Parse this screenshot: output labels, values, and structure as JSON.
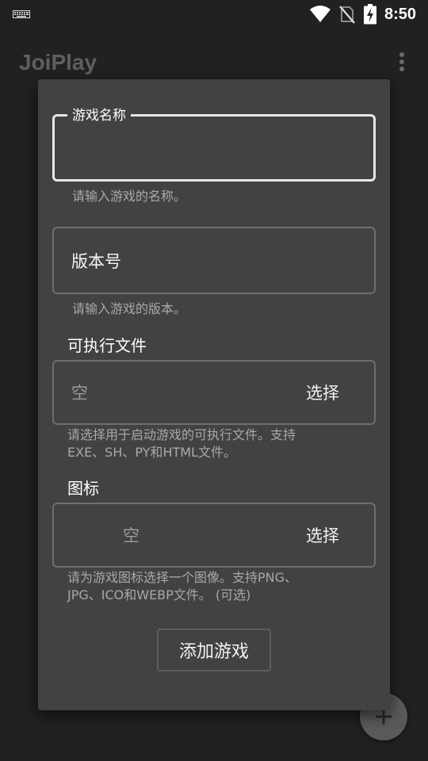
{
  "status_bar": {
    "time": "8:50",
    "icons": [
      "keyboard-icon",
      "wifi-icon",
      "no-sim-icon",
      "battery-charging-icon"
    ]
  },
  "app_bar": {
    "title": "JoiPlay",
    "menu_icon": "more-vert-icon"
  },
  "fab": {
    "icon": "plus-icon"
  },
  "dialog": {
    "game_name": {
      "label": "游戏名称",
      "value": "",
      "helper": "请输入游戏的名称。"
    },
    "version": {
      "placeholder": "版本号",
      "value": "",
      "helper": "请输入游戏的版本。"
    },
    "executable": {
      "title": "可执行文件",
      "value": "空",
      "select_label": "选择",
      "helper_line1": "请选择用于启动游戏的可执行文件。支持",
      "helper_line2": "EXE、SH、PY和HTML文件。"
    },
    "icon_file": {
      "title": "图标",
      "value": "空",
      "select_label": "选择",
      "helper_line1": "请为游戏图标选择一个图像。支持PNG、",
      "helper_line2": "JPG、ICO和WEBP文件。 (可选)"
    },
    "add_button": "添加游戏"
  },
  "colors": {
    "background": "#212121",
    "dialog": "#424242",
    "focused_border": "#e6e6e6",
    "border": "#6e6e6e",
    "helper_text": "#a8a8a8"
  }
}
